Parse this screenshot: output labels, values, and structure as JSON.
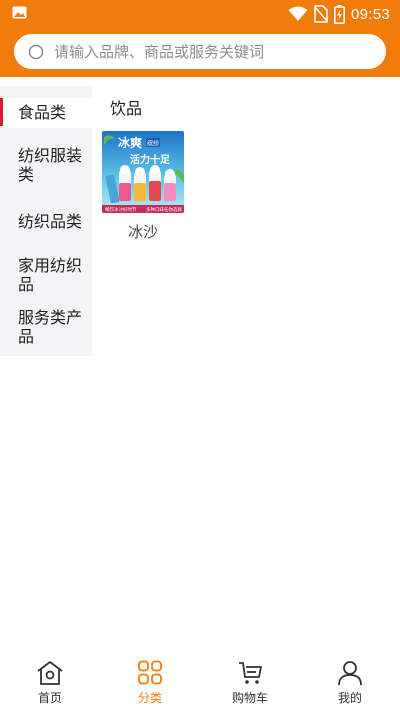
{
  "status_bar": {
    "time": "09:53",
    "icons": [
      "gallery-icon",
      "wifi-icon",
      "no-sim-icon",
      "battery-charging-icon"
    ]
  },
  "header": {
    "search_placeholder": "请输入品牌、商品或服务关键词",
    "search_icon": "search-icon"
  },
  "categories": [
    {
      "label": "食品类",
      "active": true
    },
    {
      "label": "纺织服装类",
      "active": false
    },
    {
      "label": "纺织品类",
      "active": false
    },
    {
      "label": "家用纺织品",
      "active": false
    },
    {
      "label": "服务类产品",
      "active": false
    }
  ],
  "content": {
    "section_title": "饮品",
    "products": [
      {
        "name": "冰沙",
        "image_text": {
          "headline1": "冰爽",
          "headline2": "活力十足",
          "tag": "缤纷",
          "banner_left": "畅饮冰沙好时节",
          "banner_right": "多种口味任你选择"
        }
      }
    ]
  },
  "bottom_nav": [
    {
      "label": "首页",
      "icon": "home-icon",
      "active": false
    },
    {
      "label": "分类",
      "icon": "category-grid-icon",
      "active": true
    },
    {
      "label": "购物车",
      "icon": "shopping-cart-icon",
      "active": false
    },
    {
      "label": "我的",
      "icon": "profile-icon",
      "active": false
    }
  ],
  "colors": {
    "brand_orange": "#f07c0c",
    "active_marker_red": "#e0182c",
    "sidebar_bg": "#f4f4f7"
  }
}
